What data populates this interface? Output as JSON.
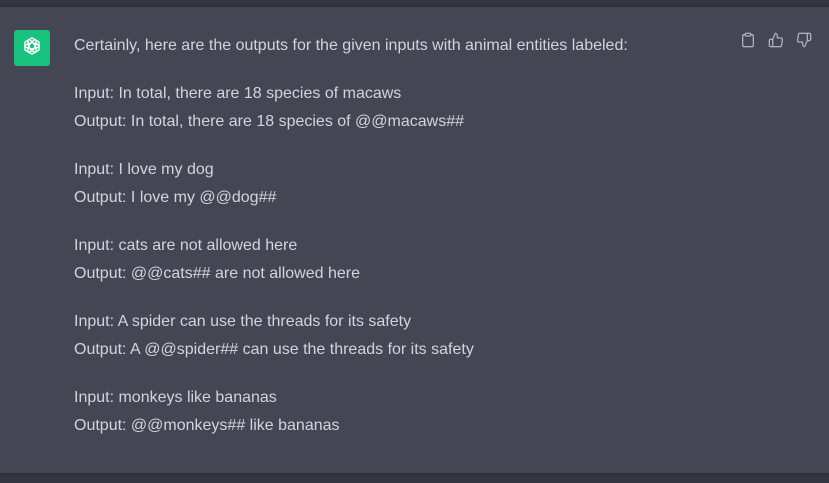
{
  "assistant": {
    "avatar_icon": "openai-logo-icon",
    "avatar_color": "#19c37d"
  },
  "message": {
    "intro": "Certainly, here are the outputs for the given inputs with animal entities labeled:",
    "pairs": [
      {
        "input": "Input: In total, there are 18 species of macaws",
        "output": "Output: In total, there are 18 species of @@macaws##"
      },
      {
        "input": "Input: I love my dog",
        "output": "Output: I love my @@dog##"
      },
      {
        "input": "Input: cats are not allowed here",
        "output": "Output: @@cats## are not allowed here"
      },
      {
        "input": "Input: A spider can use the threads for its safety",
        "output": "Output: A @@spider## can use the threads for its safety"
      },
      {
        "input": "Input: monkeys like bananas",
        "output": "Output: @@monkeys## like bananas"
      }
    ]
  },
  "actions": [
    {
      "icon": "clipboard-icon"
    },
    {
      "icon": "thumbs-up-icon"
    },
    {
      "icon": "thumbs-down-icon"
    }
  ],
  "colors": {
    "background": "#444654",
    "text": "#d1d5db",
    "icon": "#acacbe"
  }
}
